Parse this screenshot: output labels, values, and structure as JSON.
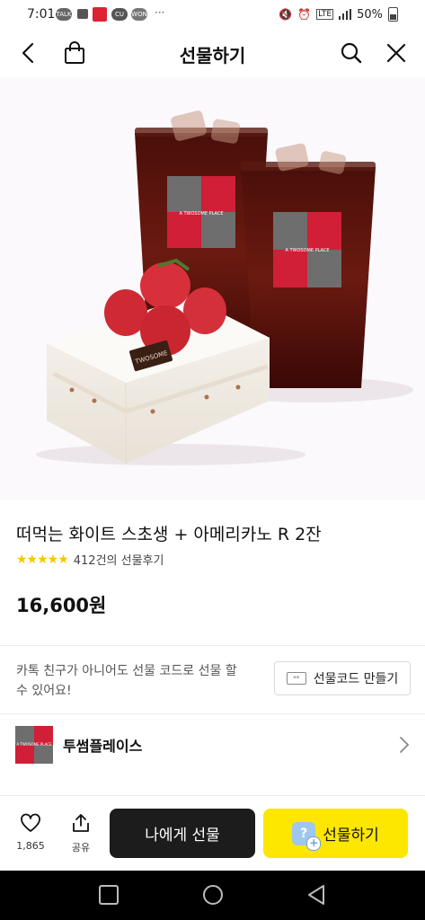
{
  "status": {
    "time": "7:01",
    "notifications": [
      "TALK",
      "CU",
      "WON"
    ],
    "battery": "50%"
  },
  "header": {
    "title": "선물하기",
    "icons": [
      "back-arrow-icon",
      "shopping-bag-icon",
      "search-icon",
      "close-icon"
    ]
  },
  "product": {
    "name": "떠먹는 화이트 스초생 + 아메리카노 R 2잔",
    "stars": "★★★★★",
    "review_text": "412건의 선물후기",
    "price": "16,600원",
    "image_labels": {
      "cup_brand": "A TWOSOME PLACE",
      "cake_tag": "TWOSOME"
    }
  },
  "gift_code": {
    "description": "카톡 친구가 아니어도 선물 코드로 선물 할 수 있어요!",
    "button_label": "선물코드 만들기"
  },
  "brand": {
    "name": "투썸플레이스",
    "logo_text": "A TWOSOME PLACE"
  },
  "actions": {
    "like_count": "1,865",
    "share_label": "공유",
    "self_gift_label": "나에게 선물",
    "gift_label": "선물하기"
  },
  "colors": {
    "kakao_yellow": "#fde600",
    "dark_button": "#1c1c1c",
    "brand_red": "#d01f36",
    "brand_gray": "#6e6e6e",
    "star": "#f6c700"
  }
}
